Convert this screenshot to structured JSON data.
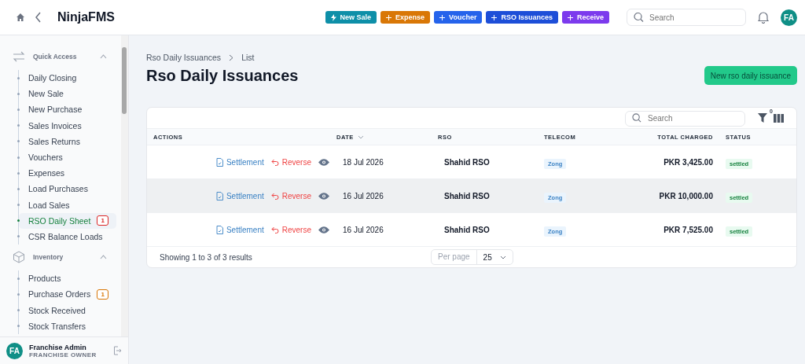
{
  "header": {
    "title": "NinjaFMS",
    "actions": [
      {
        "label": "New Sale",
        "kind": "bolt",
        "color": "#0e8fa8"
      },
      {
        "label": "Expense",
        "kind": "plus",
        "color": "#d97706"
      },
      {
        "label": "Voucher",
        "kind": "plus",
        "color": "#2563eb"
      },
      {
        "label": "RSO Issuances",
        "kind": "plus",
        "color": "#1d4ed8"
      },
      {
        "label": "Receive",
        "kind": "plus",
        "color": "#7c3aed"
      }
    ],
    "search": {
      "placeholder": "Search"
    },
    "avatar": "FA"
  },
  "sidebar": {
    "groups": [
      {
        "title": "Quick Access",
        "kind": "arrows",
        "expanded": true,
        "items": [
          {
            "label": "Daily Closing",
            "selected": false
          },
          {
            "label": "New Sale",
            "selected": false
          },
          {
            "label": "New Purchase",
            "selected": false
          },
          {
            "label": "Sales Invoices",
            "selected": false
          },
          {
            "label": "Sales Returns",
            "selected": false
          },
          {
            "label": "Vouchers",
            "selected": false
          },
          {
            "label": "Expenses",
            "selected": false
          },
          {
            "label": "Load Purchases",
            "selected": false
          },
          {
            "label": "Load Sales",
            "selected": false
          },
          {
            "label": "RSO Daily Sheet",
            "selected": true,
            "badge": {
              "text": "1",
              "color": "#dc2626"
            }
          },
          {
            "label": "CSR Balance Loads",
            "selected": false
          }
        ]
      },
      {
        "title": "Inventory",
        "kind": "box",
        "expanded": true,
        "items": [
          {
            "label": "Products",
            "selected": false
          },
          {
            "label": "Purchase Orders",
            "selected": false,
            "badge": {
              "text": "1",
              "color": "#d97706"
            }
          },
          {
            "label": "Stock Received",
            "selected": false
          },
          {
            "label": "Stock Transfers",
            "selected": false
          }
        ]
      }
    ],
    "user": {
      "avatar": "FA",
      "name": "Franchise Admin",
      "role": "FRANCHISE OWNER"
    }
  },
  "breadcrumb": [
    "Rso Daily Issuances",
    "List"
  ],
  "page_title": "Rso Daily Issuances",
  "primary_button": "New rso daily issuance",
  "table": {
    "search": {
      "placeholder": "Search"
    },
    "filter_count": "0",
    "columns": [
      "ACTIONS",
      "DATE",
      "RSO",
      "TELECOM",
      "TOTAL CHARGED",
      "STATUS"
    ],
    "rows": [
      {
        "settlement": "Settlement",
        "reverse": "Reverse",
        "date": "18 Jul 2026",
        "rso": "Shahid RSO",
        "telecom": "Zong",
        "total": "PKR 3,425.00",
        "status": "settled",
        "hovered": false
      },
      {
        "settlement": "Settlement",
        "reverse": "Reverse",
        "date": "16 Jul 2026",
        "rso": "Shahid RSO",
        "telecom": "Zong",
        "total": "PKR 10,000.00",
        "status": "settled",
        "hovered": true
      },
      {
        "settlement": "Settlement",
        "reverse": "Reverse",
        "date": "16 Jul 2026",
        "rso": "Shahid RSO",
        "telecom": "Zong",
        "total": "PKR 7,525.00",
        "status": "settled",
        "hovered": false
      }
    ],
    "summary": "Showing 1 to 3 of 3 results",
    "per_page_label": "Per page",
    "per_page": "25"
  }
}
